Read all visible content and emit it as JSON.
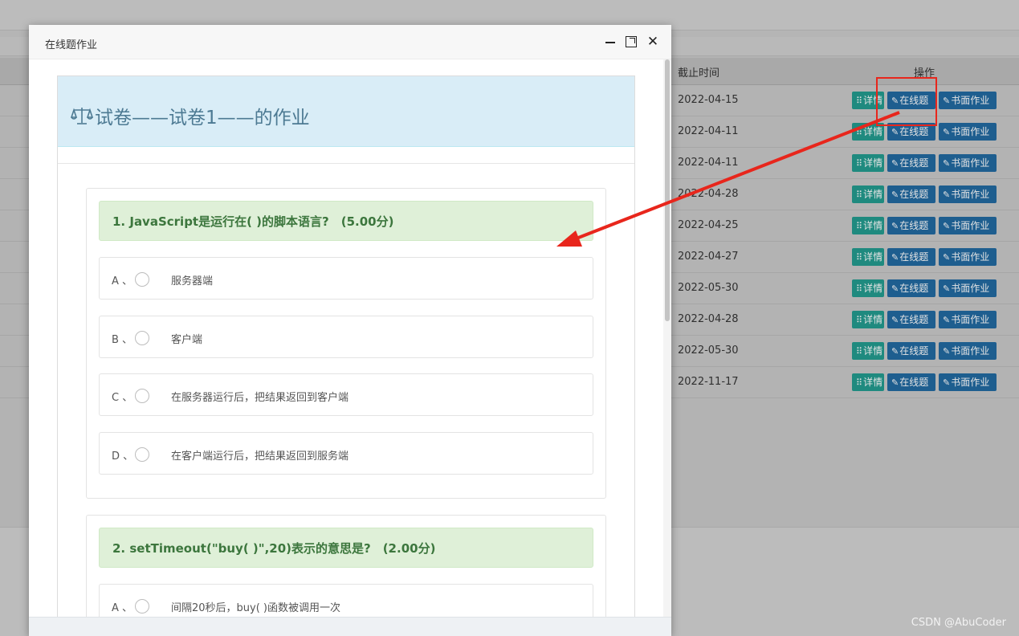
{
  "background": {
    "columns": {
      "deadline": "截止时间",
      "actions": "操作"
    },
    "rows": [
      {
        "deadline": "2022-04-15"
      },
      {
        "deadline": "2022-04-11"
      },
      {
        "deadline": "2022-04-11"
      },
      {
        "deadline": "2022-04-28"
      },
      {
        "deadline": "2022-04-25"
      },
      {
        "deadline": "2022-04-27"
      },
      {
        "deadline": "2022-05-30"
      },
      {
        "deadline": "2022-04-28"
      },
      {
        "deadline": "2022-05-30"
      },
      {
        "deadline": "2022-11-17"
      }
    ],
    "buttons": {
      "detail": "详情",
      "online": "在线题",
      "paper": "书面作业"
    },
    "watermark": "CSDN @AbuCoder"
  },
  "modal": {
    "title": "在线题作业",
    "exam_title": "试卷——试卷1——的作业",
    "questions": [
      {
        "text": "1. JavaScript是运行在( )的脚本语言?　(5.00分)",
        "options": [
          {
            "letter": "A 、",
            "text": "服务器端"
          },
          {
            "letter": "B 、",
            "text": "客户端"
          },
          {
            "letter": "C 、",
            "text": "在服务器运行后，把结果返回到客户端"
          },
          {
            "letter": "D 、",
            "text": "在客户端运行后，把结果返回到服务端"
          }
        ]
      },
      {
        "text": "2. setTimeout(\"buy( )\",20)表示的意思是?　(2.00分)",
        "options": [
          {
            "letter": "A 、",
            "text": "间隔20秒后，buy( )函数被调用一次"
          }
        ]
      }
    ]
  },
  "colors": {
    "annotation": "#e8261c",
    "heading_bg": "#d9edf7",
    "question_bg": "#dff0d8",
    "question_text": "#3c763d",
    "detail_button": "#1f8a7f",
    "action_button": "#1e5e8f"
  }
}
